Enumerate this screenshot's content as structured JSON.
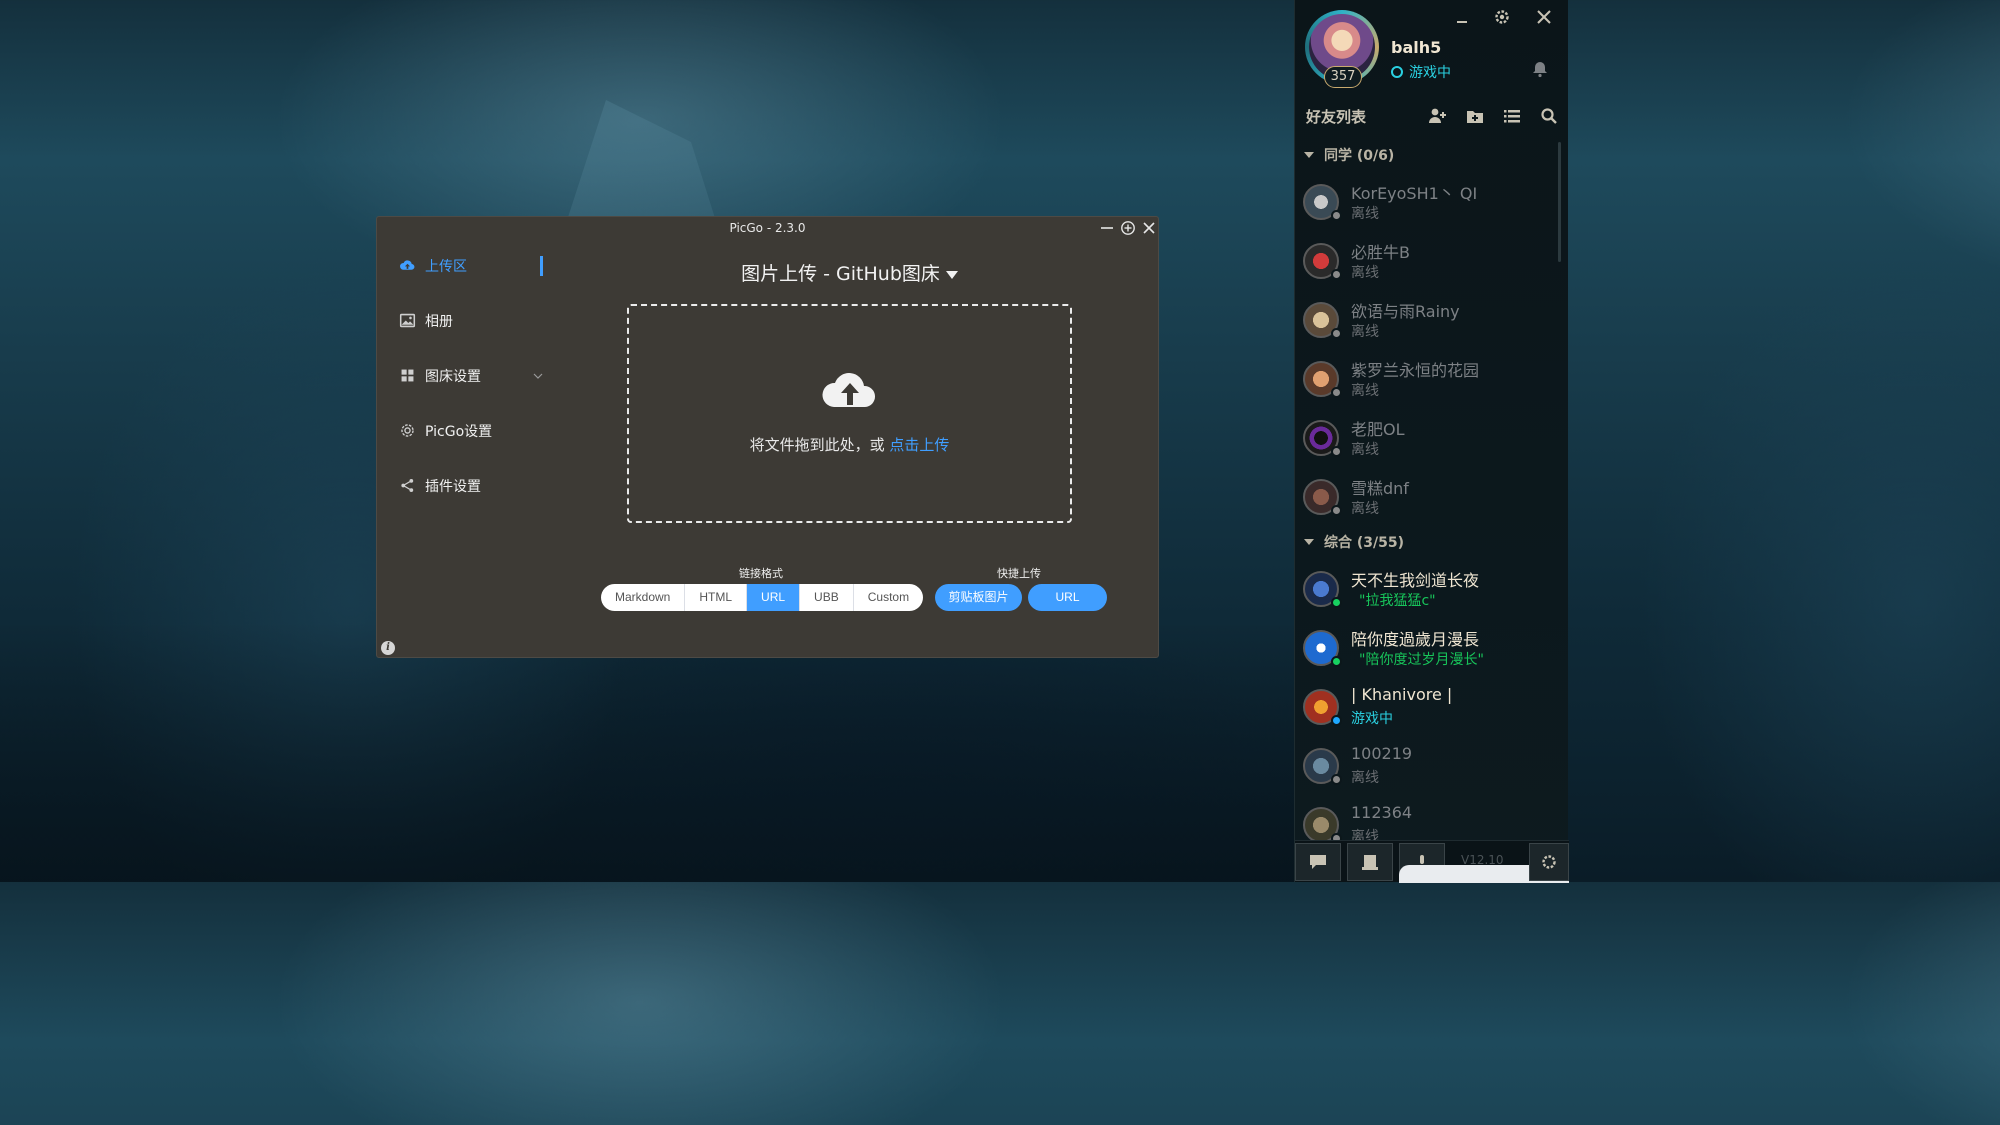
{
  "picgo": {
    "title": "PicGo - 2.3.0",
    "sidebar": [
      {
        "label": "上传区",
        "icon": "cloud-upload-icon",
        "active": true
      },
      {
        "label": "相册",
        "icon": "image-icon"
      },
      {
        "label": "图床设置",
        "icon": "grid-icon"
      },
      {
        "label": "PicGo设置",
        "icon": "gear-icon"
      },
      {
        "label": "插件设置",
        "icon": "share-icon"
      }
    ],
    "heading": "图片上传 - GitHub图床",
    "drop_text": "将文件拖到此处，或",
    "drop_link": "点击上传",
    "link_format_label": "链接格式",
    "link_formats": [
      "Markdown",
      "HTML",
      "URL",
      "UBB",
      "Custom"
    ],
    "selected_format": "URL",
    "quick_upload_label": "快捷上传",
    "quick_buttons": [
      "剪贴板图片",
      "URL"
    ],
    "accent": "#409eff",
    "bg": "#3d3a35"
  },
  "client": {
    "username": "balh5",
    "level": "357",
    "status": "游戏中",
    "friend_list_title": "好友列表",
    "groups": [
      {
        "name": "同学 (0/6)",
        "friends": [
          {
            "name": "KorEyoSH1丶 QI",
            "sub": "离线",
            "state": "offline"
          },
          {
            "name": "必胜牛B",
            "sub": "离线",
            "state": "offline"
          },
          {
            "name": "欲语与雨Rainy",
            "sub": "离线",
            "state": "offline"
          },
          {
            "name": "紫罗兰永恒的花园",
            "sub": "离线",
            "state": "offline"
          },
          {
            "name": "老肥OL",
            "sub": "离线",
            "state": "offline"
          },
          {
            "name": "雪糕dnf",
            "sub": "离线",
            "state": "offline"
          }
        ]
      },
      {
        "name": "综合 (3/55)",
        "friends": [
          {
            "name": "天不生我剑道长夜",
            "sub": "\"拉我猛猛c\"",
            "state": "online"
          },
          {
            "name": "陪你度過歲月漫長",
            "sub": "\"陪你度过岁月漫长\"",
            "state": "online"
          },
          {
            "name": "| Khanivore |",
            "sub": "游戏中",
            "state": "ingame"
          },
          {
            "name": "100219",
            "sub": "离线",
            "state": "offline"
          },
          {
            "name": "112364",
            "sub": "离线",
            "state": "offline"
          }
        ]
      }
    ],
    "version": "V12.10"
  }
}
